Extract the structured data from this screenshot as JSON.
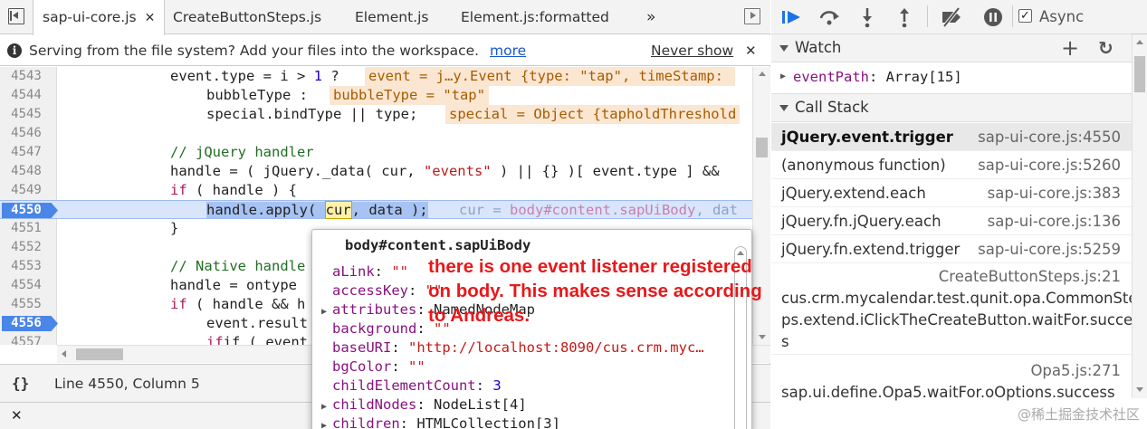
{
  "editor": {
    "tabs": [
      {
        "label": "sap-ui-core.js",
        "close": "✕"
      },
      {
        "label": "CreateButtonSteps.js"
      },
      {
        "label": "Element.js"
      },
      {
        "label": "Element.js:formatted"
      }
    ],
    "more_tabs": "»",
    "infobar": {
      "message": "Serving from the file system? Add your files into the workspace.",
      "more_link": "more",
      "never_show": "Never show",
      "close": "✕"
    },
    "lines": [
      {
        "n": "4543"
      },
      {
        "n": "4544"
      },
      {
        "n": "4545"
      },
      {
        "n": "4546"
      },
      {
        "n": "4547"
      },
      {
        "n": "4548"
      },
      {
        "n": "4549"
      },
      {
        "n": "4550"
      },
      {
        "n": "4551"
      },
      {
        "n": "4552"
      },
      {
        "n": "4553"
      },
      {
        "n": "4554"
      },
      {
        "n": "4555"
      },
      {
        "n": "4556"
      },
      {
        "n": "4557"
      }
    ],
    "code": {
      "l4543_a": "event.type = i > ",
      "l4543_num": "1",
      "l4543_b": " ?",
      "l4543_inline": "event = j…y.Event {type: \"tap\", timeStamp: ",
      "l4544": "bubbleType :",
      "l4544_inline": "bubbleType = \"tap\"",
      "l4545": "special.bindType || type;",
      "l4545_inline": "special = Object {tapholdThreshold",
      "l4547": "// jQuery handler",
      "l4548_a": "handle = ( jQuery._data( cur, ",
      "l4548_str": "\"events\"",
      "l4548_b": " ) || {} )[ event.type ] &&",
      "l4549_kw": "if",
      "l4549_b": " ( handle ) {",
      "l4550_a": "handle.apply( ",
      "l4550_cur": "cur",
      "l4550_b": ", data );",
      "l4550_inline_a": "cur = ",
      "l4550_inline_b": "body#content.sapUiBody",
      "l4550_inline_c": ", dat",
      "l4551": "}",
      "l4553": "// Native handle",
      "l4554": "handle = ontype",
      "l4555_kw": "if",
      "l4555_b": " ( handle && h",
      "l4556": "event.result",
      "l4557": "if ( event.r"
    },
    "status": {
      "braces": "{}",
      "position": "Line 4550, Column 5"
    },
    "console_close": "✕"
  },
  "popover": {
    "title": "body#content.sapUiBody",
    "rows": [
      {
        "key": "aLink",
        "value": "\"\"",
        "type": "str",
        "expandable": false
      },
      {
        "key": "accessKey",
        "value": "\"\"",
        "type": "str",
        "expandable": false
      },
      {
        "key": "attributes",
        "value": "NamedNodeMap",
        "type": "obj",
        "expandable": true
      },
      {
        "key": "background",
        "value": "\"\"",
        "type": "str",
        "expandable": false
      },
      {
        "key": "baseURI",
        "value": "\"http://localhost:8090/cus.crm.myc…",
        "type": "str",
        "expandable": false
      },
      {
        "key": "bgColor",
        "value": "\"\"",
        "type": "str",
        "expandable": false
      },
      {
        "key": "childElementCount",
        "value": "3",
        "type": "num",
        "expandable": false
      },
      {
        "key": "childNodes",
        "value": "NodeList[4]",
        "type": "obj",
        "expandable": true
      },
      {
        "key": "children",
        "value": "HTMLCollection[3]",
        "type": "obj",
        "expandable": true
      }
    ]
  },
  "annotation": {
    "line1": "there is one event listener registered",
    "line2": "on body. This makes sense according",
    "line3": "to Andreas."
  },
  "debugger": {
    "async_label": "Async",
    "async_checked": "✓",
    "watch": {
      "title": "Watch",
      "add": "+",
      "refresh": "↻",
      "items": [
        {
          "name": "eventPath",
          "value": "Array[15]"
        }
      ]
    },
    "call_stack": {
      "title": "Call Stack",
      "frames": [
        {
          "fn": "jQuery.event.trigger",
          "loc": "sap-ui-core.js:4550",
          "selected": true
        },
        {
          "fn": "(anonymous function)",
          "loc": "sap-ui-core.js:5260"
        },
        {
          "fn": "jQuery.extend.each",
          "loc": "sap-ui-core.js:383"
        },
        {
          "fn": "jQuery.fn.jQuery.each",
          "loc": "sap-ui-core.js:136"
        },
        {
          "fn": "jQuery.fn.extend.trigger",
          "loc": "sap-ui-core.js:5259"
        }
      ],
      "long_frame": {
        "loc": "CreateButtonSteps.js:21",
        "fn_line1": "cus.crm.mycalendar.test.qunit.opa.CommonSte",
        "fn_line2": "ps.extend.iClickTheCreateButton.waitFor.succes",
        "fn_line3": "s"
      },
      "opa_frame": {
        "loc": "Opa5.js:271",
        "fn": "sap.ui.define.Opa5.waitFor.oOptions.success"
      }
    }
  },
  "watermark": "@稀土掘金技术社区",
  "colors": {
    "accent": "#4a86e8",
    "annotation": "#e8181a",
    "toolbar_blue": "#1a73e8"
  }
}
